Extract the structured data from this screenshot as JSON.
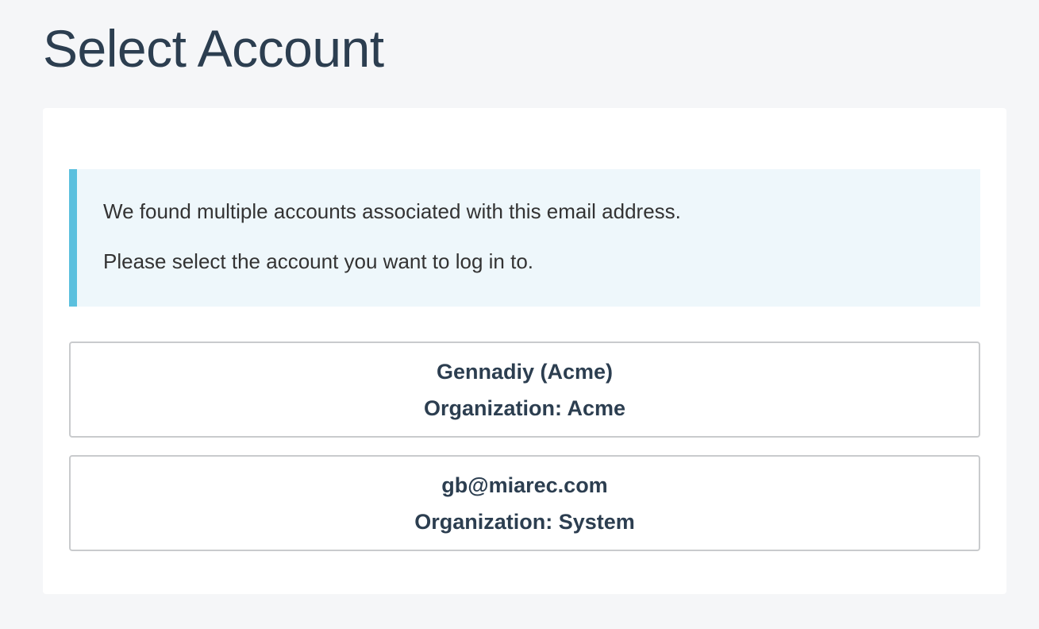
{
  "page": {
    "title": "Select Account"
  },
  "alert": {
    "line1": "We found multiple accounts associated with this email address.",
    "line2": "Please select the account you want to log in to."
  },
  "accounts": [
    {
      "name": "Gennadiy (Acme)",
      "organization": "Organization: Acme"
    },
    {
      "name": "gb@miarec.com",
      "organization": "Organization: System"
    }
  ],
  "colors": {
    "background": "#f5f6f8",
    "text": "#2c3e50",
    "alert_background": "#eef7fb",
    "alert_accent": "#5bc0de",
    "option_border": "#c9cbcd"
  }
}
